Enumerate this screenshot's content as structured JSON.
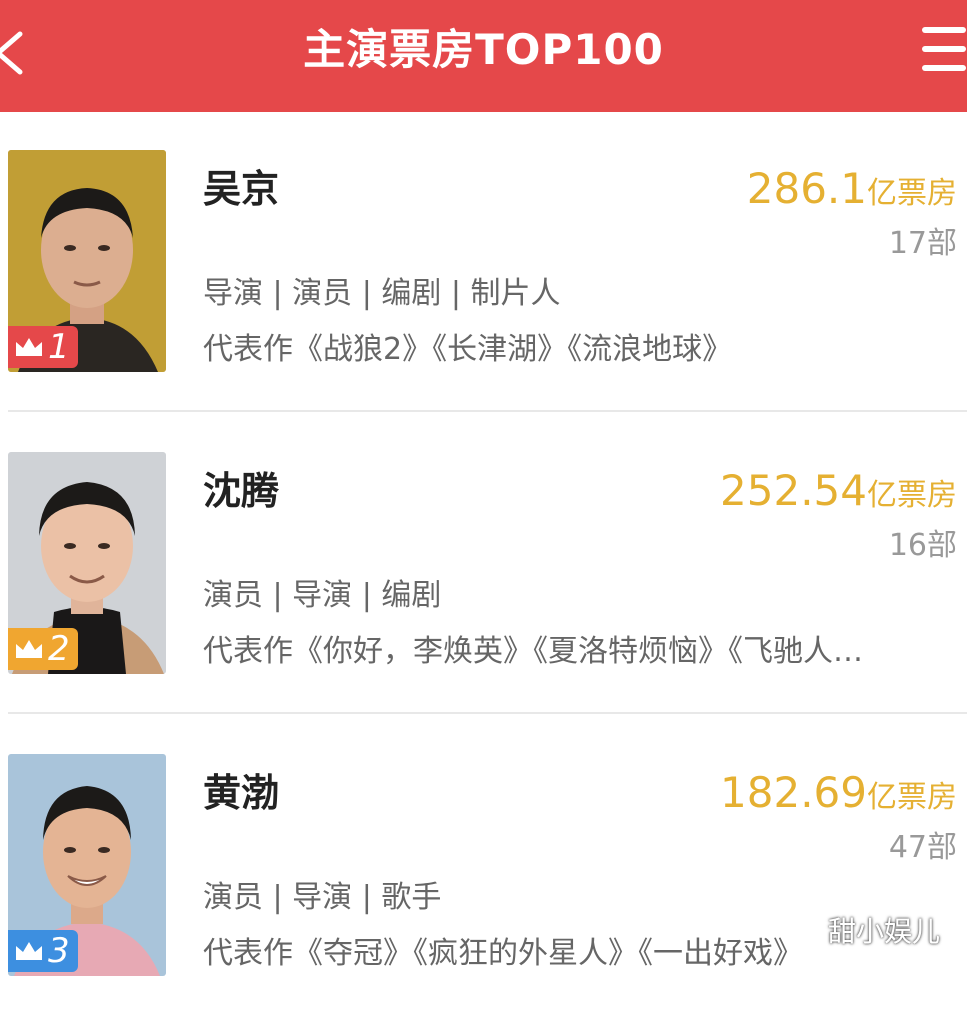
{
  "header": {
    "title": "主演票房TOP100",
    "back_icon": "back-chevron-icon",
    "menu_icon": "hamburger-menu-icon",
    "background_color": "#e5484a"
  },
  "actors": [
    {
      "rank": "1",
      "name": "吴京",
      "box_office": "286.1",
      "box_office_unit": "亿票房",
      "film_count": "17部",
      "roles": "导演 | 演员 | 编剧 | 制片人",
      "works": "代表作《战狼2》《长津湖》《流浪地球》",
      "badge_color": "#e5484a",
      "photo_bg": "#b8962a"
    },
    {
      "rank": "2",
      "name": "沈腾",
      "box_office": "252.54",
      "box_office_unit": "亿票房",
      "film_count": "16部",
      "roles": "演员 | 导演 | 编剧",
      "works": "代表作《你好，李焕英》《夏洛特烦恼》《飞驰人…",
      "badge_color": "#f0a630",
      "photo_bg": "#cfd2d6"
    },
    {
      "rank": "3",
      "name": "黄渤",
      "box_office": "182.69",
      "box_office_unit": "亿票房",
      "film_count": "47部",
      "roles": "演员 | 导演 | 歌手",
      "works": "代表作《夺冠》《疯狂的外星人》《一出好戏》",
      "badge_color": "#3d8fe0",
      "photo_bg": "#a9c4da"
    }
  ],
  "watermark": "甜小娱儿",
  "accent_color": "#e5b032"
}
